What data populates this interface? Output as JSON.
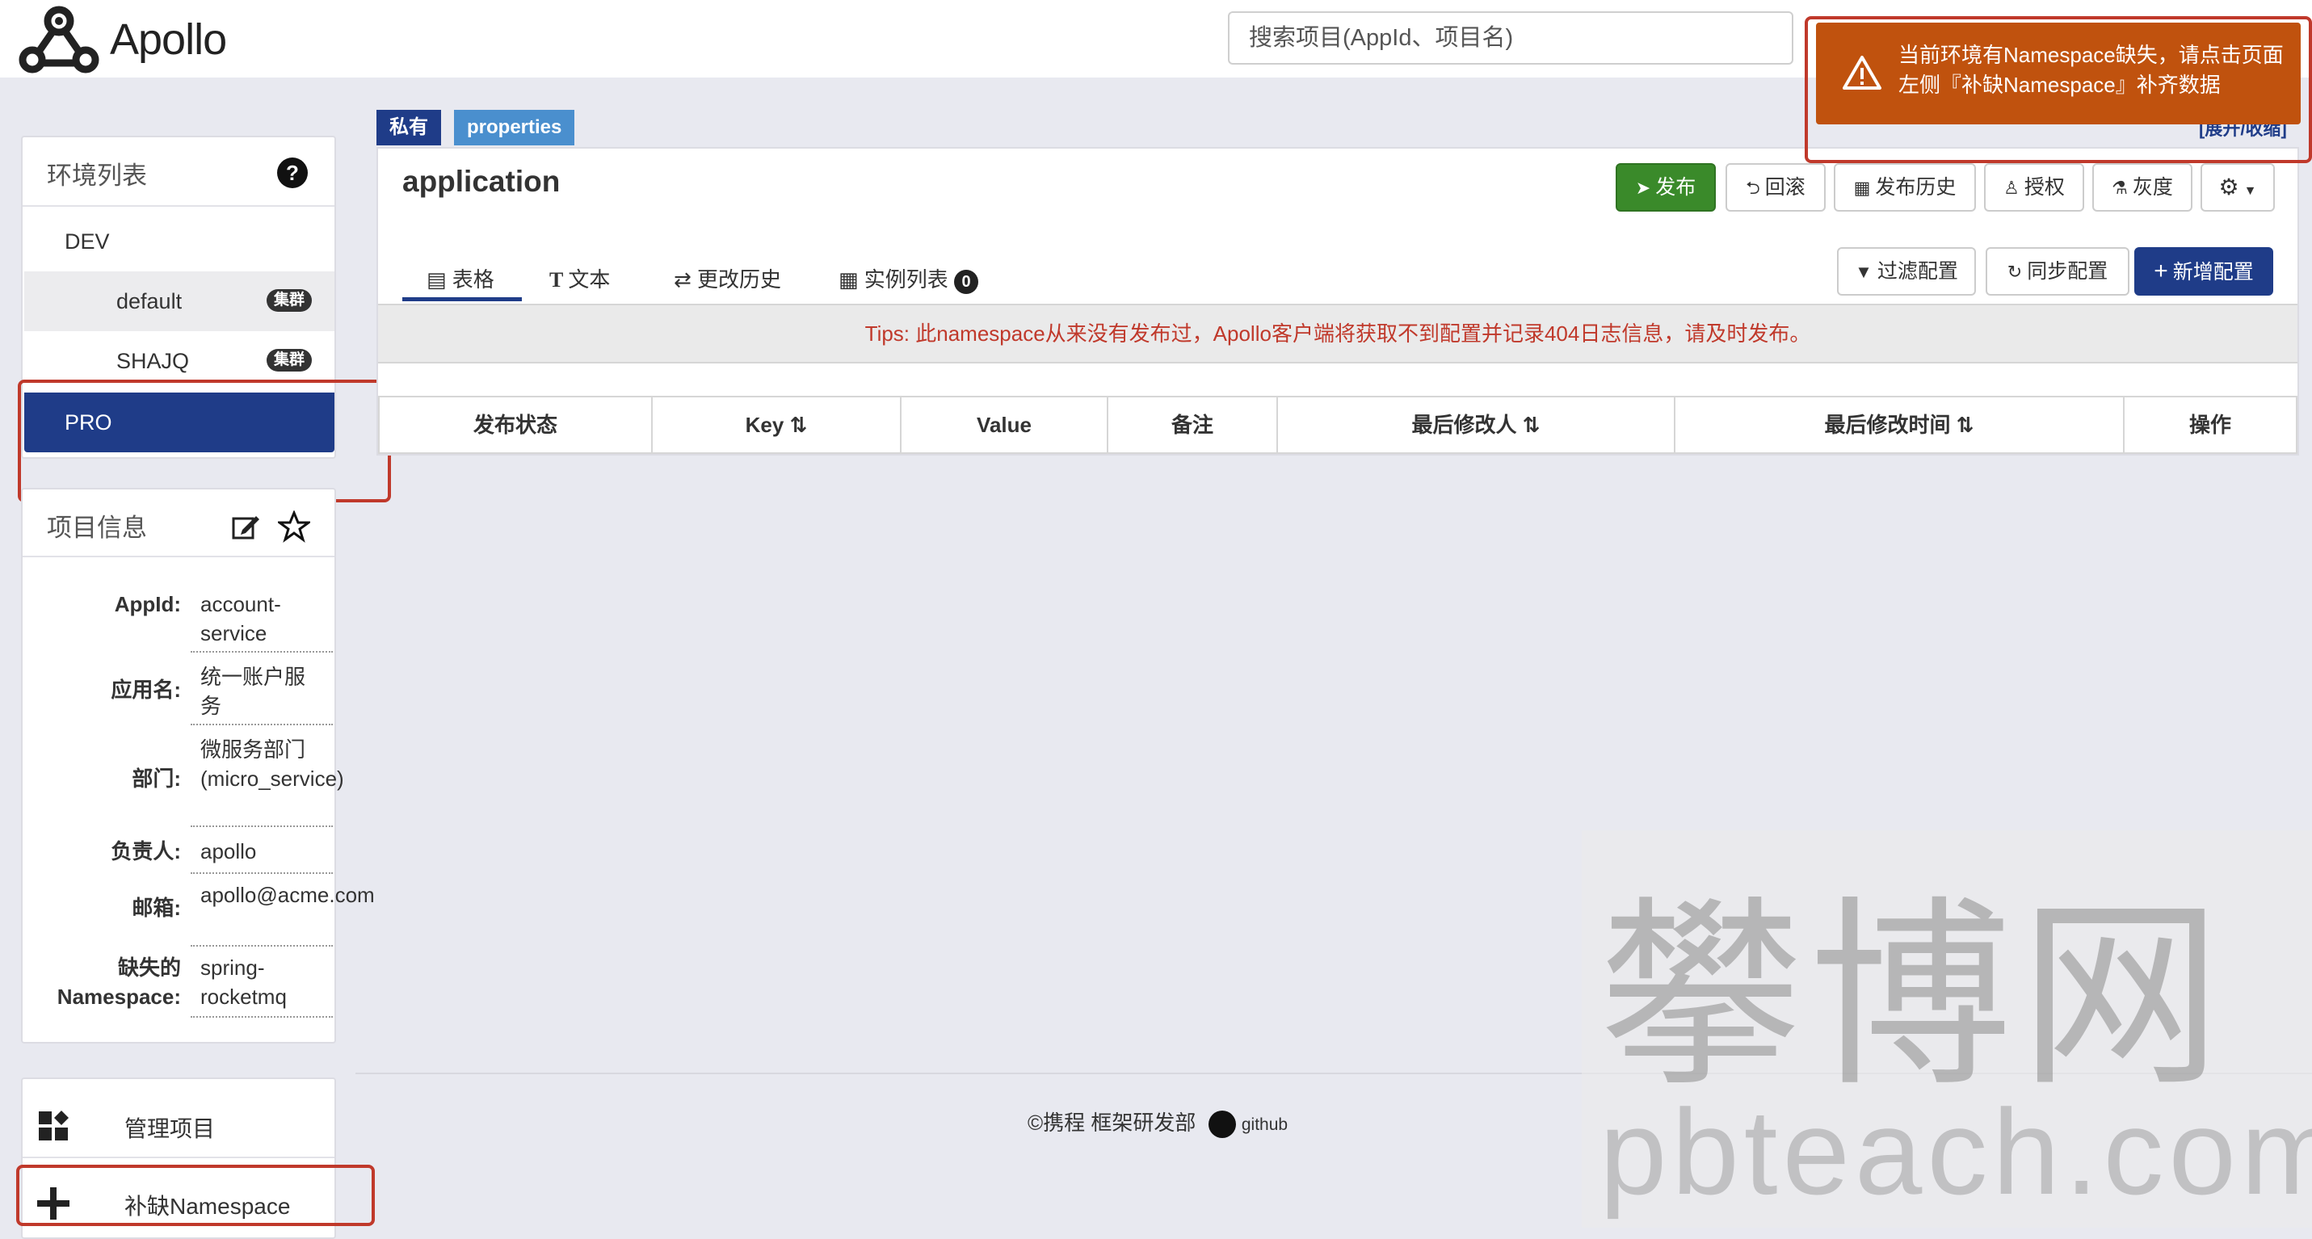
{
  "header": {
    "logo_text": "Apollo",
    "search_placeholder": "搜索项目(AppId、项目名)"
  },
  "alert": {
    "text": "当前环境有Namespace缺失，请点击页面左侧『补缺Namespace』补齐数据",
    "expand_label": "[展开/收缩]"
  },
  "env_panel": {
    "title": "环境列表",
    "items": [
      {
        "label": "DEV"
      },
      {
        "label": "default",
        "badge": "集群"
      },
      {
        "label": "SHAJQ",
        "badge": "集群"
      },
      {
        "label": "PRO"
      }
    ]
  },
  "info_panel": {
    "title": "项目信息",
    "rows": [
      {
        "label": "AppId:",
        "value": "account-service"
      },
      {
        "label": "应用名:",
        "value": "统一账户服务"
      },
      {
        "label": "部门:",
        "value": "微服务部门(micro_service)"
      },
      {
        "label": "负责人:",
        "value": "apollo"
      },
      {
        "label": "邮箱:",
        "value": "apollo@acme.com"
      },
      {
        "label": "缺失的 Namespace:",
        "value": "spring-rocketmq"
      }
    ]
  },
  "manage_panel": {
    "manage_label": "管理项目",
    "add_namespace_label": "补缺Namespace"
  },
  "namespace": {
    "tag_private": "私有",
    "tag_format": "properties",
    "title": "application",
    "buttons": {
      "publish": "发布",
      "rollback": "回滚",
      "history": "发布历史",
      "grant": "授权",
      "gray": "灰度"
    },
    "tabs": {
      "table": "表格",
      "text": "文本",
      "history": "更改历史",
      "instances": "实例列表",
      "instances_count": "0"
    },
    "actions": {
      "filter": "过滤配置",
      "sync": "同步配置",
      "add": "新增配置"
    },
    "tips": "Tips: 此namespace从来没有发布过，Apollo客户端将获取不到配置并记录404日志信息，请及时发布。",
    "columns": [
      "发布状态",
      "Key",
      "Value",
      "备注",
      "最后修改人",
      "最后修改时间",
      "操作"
    ]
  },
  "footer": {
    "copyright": "©携程 框架研发部",
    "github": "github"
  },
  "watermark": {
    "cn": "攀博网",
    "en": "pbteach.com"
  },
  "colors": {
    "primary": "#1f3c88",
    "success": "#3a8a2a",
    "alert": "#c0520e",
    "highlight": "#c0392b"
  }
}
